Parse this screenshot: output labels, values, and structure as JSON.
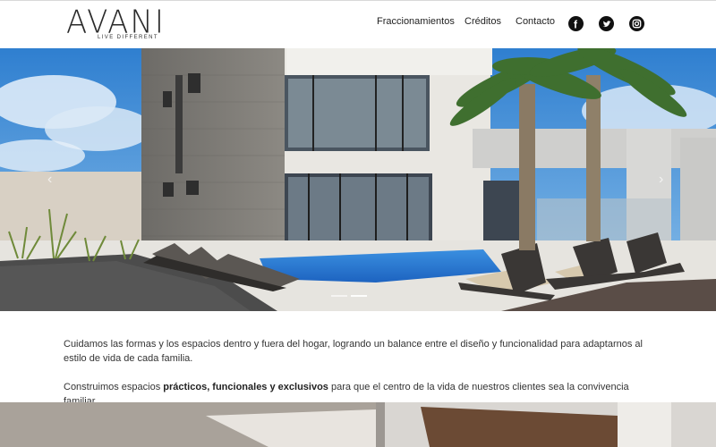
{
  "brand": {
    "name": "AVANI",
    "tagline": "LIVE DIFFERENT"
  },
  "nav": {
    "items": [
      {
        "label": "Fraccionamientos"
      },
      {
        "label": "Créditos"
      },
      {
        "label": "Contacto"
      }
    ],
    "social": [
      "facebook-icon",
      "twitter-icon",
      "instagram-icon"
    ]
  },
  "hero": {
    "prev_label": "‹",
    "next_label": "›"
  },
  "content": {
    "paragraph1": "Cuidamos las formas y los espacios dentro y fuera del hogar, logrando un balance entre el diseño y funcionalidad para adaptarnos al estilo de vida de cada familia.",
    "paragraph2_before": "Construimos espacios ",
    "paragraph2_bold": "prácticos, funcionales y exclusivos",
    "paragraph2_after": " para que el centro de la vida de nuestros clientes sea la convivencia familiar."
  },
  "colors": {
    "text": "#333333",
    "pool": "#2f7fd8",
    "sky": "#3f8fd6"
  }
}
